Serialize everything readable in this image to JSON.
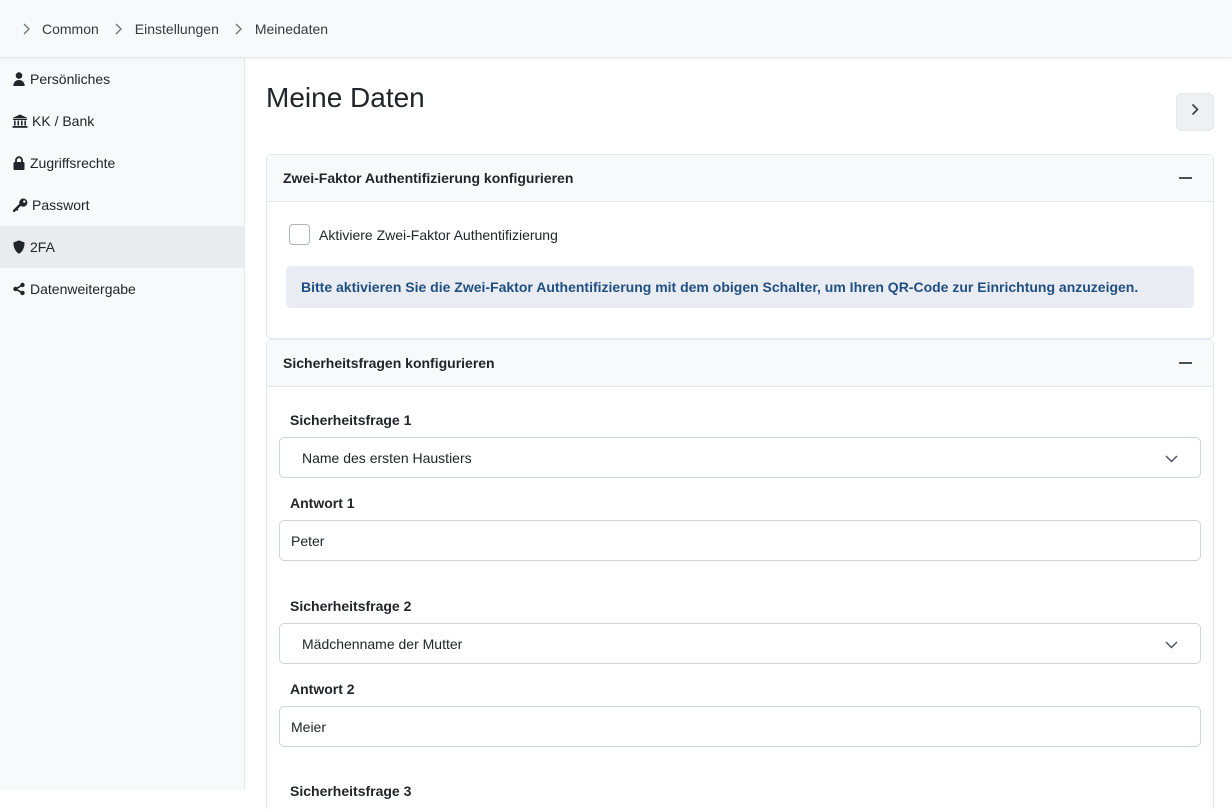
{
  "breadcrumb": [
    "Common",
    "Einstellungen",
    "Meinedaten"
  ],
  "sidebar": {
    "items": [
      {
        "label": "Persönliches",
        "icon": "user-icon"
      },
      {
        "label": "KK / Bank",
        "icon": "bank-icon"
      },
      {
        "label": "Zugriffsrechte",
        "icon": "lock-icon"
      },
      {
        "label": "Passwort",
        "icon": "key-icon"
      },
      {
        "label": "2FA",
        "icon": "shield-icon",
        "active": true
      },
      {
        "label": "Datenweitergabe",
        "icon": "share-icon"
      }
    ]
  },
  "page": {
    "title": "Meine Daten"
  },
  "twofa": {
    "header": "Zwei-Faktor Authentifizierung konfigurieren",
    "checkbox_label": "Aktiviere Zwei-Faktor Authentifizierung",
    "checked": false,
    "info": "Bitte aktivieren Sie die Zwei-Faktor Authentifizierung mit dem obigen Schalter, um Ihren QR-Code zur Einrichtung anzuzeigen."
  },
  "security": {
    "header": "Sicherheitsfragen konfigurieren",
    "questions": [
      {
        "label": "Sicherheitsfrage 1",
        "selected": "Name des ersten Haustiers",
        "answer_label": "Antwort 1",
        "answer": "Peter"
      },
      {
        "label": "Sicherheitsfrage 2",
        "selected": "Mädchenname der Mutter",
        "answer_label": "Antwort 2",
        "answer": "Meier"
      },
      {
        "label": "Sicherheitsfrage 3"
      }
    ]
  },
  "colors": {
    "accent_text": "#1f4f82",
    "info_bg": "#e9ecf2",
    "active_bg": "#e9ebee"
  }
}
